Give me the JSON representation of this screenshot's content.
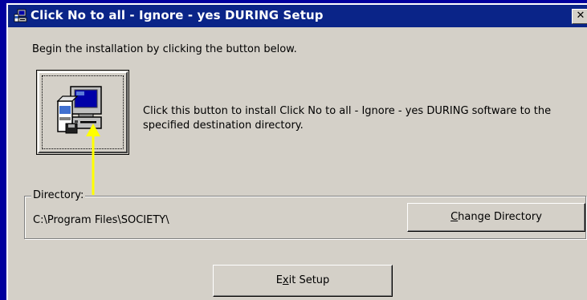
{
  "window": {
    "title": "Click No to all - Ignore - yes DURING Setup",
    "close_glyph": "✕"
  },
  "main": {
    "intro_text": "Begin the installation by clicking the button below.",
    "install_description": "Click this button to install Click No to all - Ignore - yes DURING software to the specified destination directory.",
    "install_icon": "computer-install-icon"
  },
  "directory": {
    "label": "Directory:",
    "path": "C:\\Program Files\\SOCIETY\\",
    "change_button": {
      "accel": "C",
      "rest": "hange Directory"
    }
  },
  "exit_button": {
    "pre": "E",
    "accel": "x",
    "rest": "it Setup"
  },
  "annotation": {
    "arrow_color": "#ffff00"
  },
  "colors": {
    "desktop": "#00009e",
    "titlebar": "#0a2488",
    "dialog_face": "#d4d0c8"
  }
}
